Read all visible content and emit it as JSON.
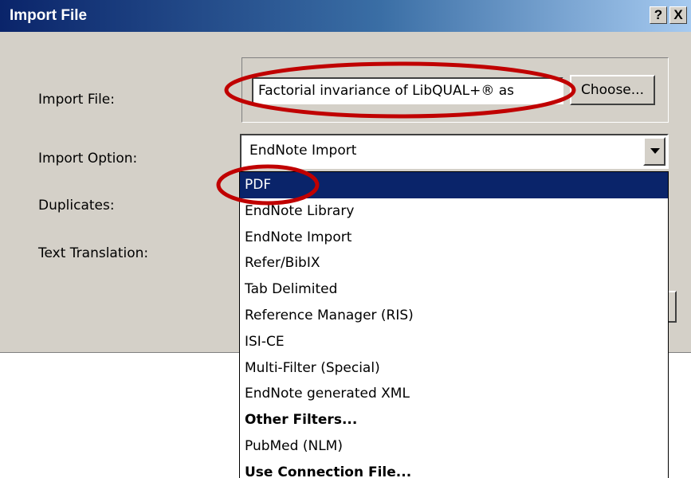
{
  "window": {
    "title": "Import File",
    "help_label": "?",
    "close_label": "X"
  },
  "form": {
    "import_file_label": "Import File:",
    "import_option_label": "Import Option:",
    "duplicates_label": "Duplicates:",
    "text_translation_label": "Text Translation:",
    "file_value": "Factorial invariance of LibQUAL+® as",
    "choose_label": "Choose...",
    "import_option_value": "EndNote Import"
  },
  "dropdown": {
    "items": [
      {
        "label": "PDF",
        "selected": true,
        "bold": false
      },
      {
        "label": "EndNote Library",
        "selected": false,
        "bold": false
      },
      {
        "label": "EndNote Import",
        "selected": false,
        "bold": false
      },
      {
        "label": "Refer/BibIX",
        "selected": false,
        "bold": false
      },
      {
        "label": "Tab Delimited",
        "selected": false,
        "bold": false
      },
      {
        "label": "Reference Manager (RIS)",
        "selected": false,
        "bold": false
      },
      {
        "label": "ISI-CE",
        "selected": false,
        "bold": false
      },
      {
        "label": "Multi-Filter (Special)",
        "selected": false,
        "bold": false
      },
      {
        "label": "EndNote generated XML",
        "selected": false,
        "bold": false
      },
      {
        "label": "Other Filters...",
        "selected": false,
        "bold": true
      },
      {
        "label": "PubMed (NLM)",
        "selected": false,
        "bold": false
      },
      {
        "label": "Use Connection File...",
        "selected": false,
        "bold": true
      }
    ]
  },
  "colors": {
    "titlebar_start": "#0a246a",
    "selection": "#0a246a",
    "dialog_face": "#d4d0c8",
    "annotation": "#c00000"
  }
}
